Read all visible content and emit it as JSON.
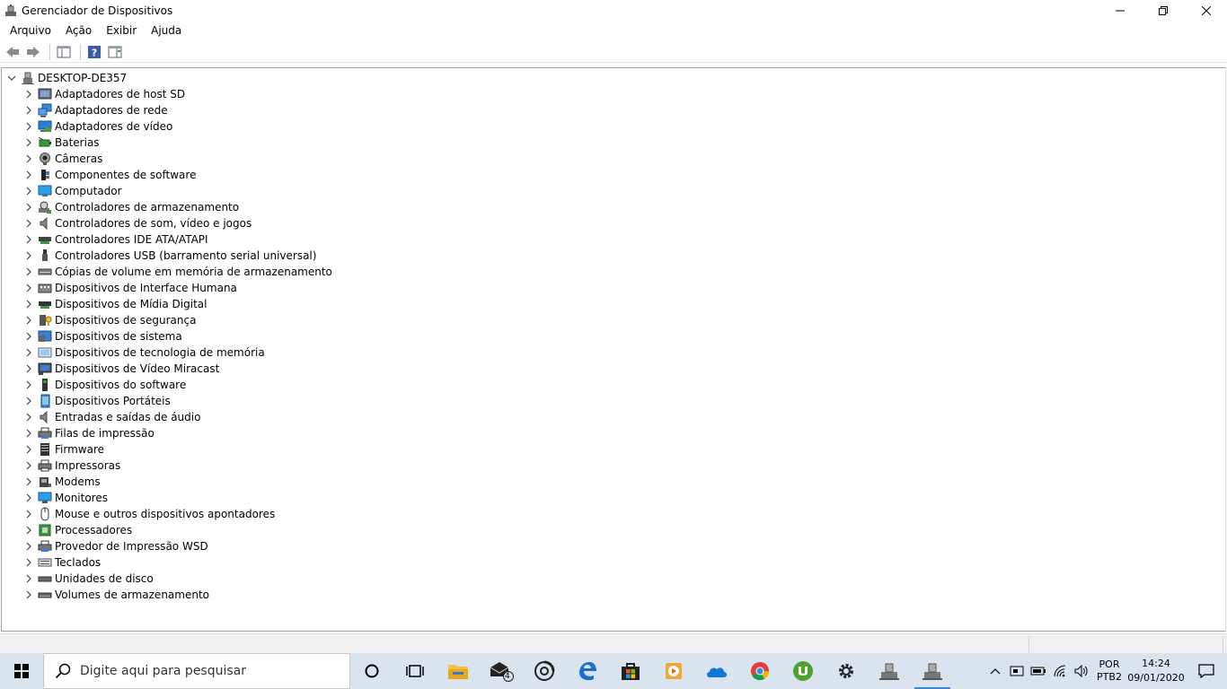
{
  "window": {
    "title": "Gerenciador de Dispositivos"
  },
  "menu": [
    "Arquivo",
    "Ação",
    "Exibir",
    "Ajuda"
  ],
  "tree": {
    "root": "DESKTOP-DE357",
    "items": [
      {
        "label": "Adaptadores de host SD",
        "icon": "sd-host-icon"
      },
      {
        "label": "Adaptadores de rede",
        "icon": "network-adapter-icon"
      },
      {
        "label": "Adaptadores de vídeo",
        "icon": "display-adapter-icon"
      },
      {
        "label": "Baterias",
        "icon": "battery-icon"
      },
      {
        "label": "Câmeras",
        "icon": "camera-icon"
      },
      {
        "label": "Componentes de software",
        "icon": "software-component-icon"
      },
      {
        "label": "Computador",
        "icon": "computer-icon"
      },
      {
        "label": "Controladores de armazenamento",
        "icon": "storage-controller-icon"
      },
      {
        "label": "Controladores de som, vídeo e jogos",
        "icon": "sound-icon"
      },
      {
        "label": "Controladores IDE ATA/ATAPI",
        "icon": "ide-controller-icon"
      },
      {
        "label": "Controladores USB (barramento serial universal)",
        "icon": "usb-icon"
      },
      {
        "label": "Cópias de volume em memória de armazenamento",
        "icon": "volume-shadow-icon"
      },
      {
        "label": "Dispositivos de Interface Humana",
        "icon": "hid-icon"
      },
      {
        "label": "Dispositivos de Mídia Digital",
        "icon": "digital-media-icon"
      },
      {
        "label": "Dispositivos de segurança",
        "icon": "security-device-icon"
      },
      {
        "label": "Dispositivos de sistema",
        "icon": "system-device-icon"
      },
      {
        "label": "Dispositivos de tecnologia de memória",
        "icon": "memory-tech-icon"
      },
      {
        "label": "Dispositivos de Vídeo Miracast",
        "icon": "miracast-icon"
      },
      {
        "label": "Dispositivos do software",
        "icon": "software-device-icon"
      },
      {
        "label": "Dispositivos Portáteis",
        "icon": "portable-device-icon"
      },
      {
        "label": "Entradas e saídas de áudio",
        "icon": "audio-io-icon"
      },
      {
        "label": "Filas de impressão",
        "icon": "print-queue-icon"
      },
      {
        "label": "Firmware",
        "icon": "firmware-icon"
      },
      {
        "label": "Impressoras",
        "icon": "printer-icon"
      },
      {
        "label": "Modems",
        "icon": "modem-icon"
      },
      {
        "label": "Monitores",
        "icon": "monitor-icon"
      },
      {
        "label": "Mouse e outros dispositivos apontadores",
        "icon": "mouse-icon"
      },
      {
        "label": "Processadores",
        "icon": "processor-icon"
      },
      {
        "label": "Provedor de Impressão WSD",
        "icon": "wsd-print-icon"
      },
      {
        "label": "Teclados",
        "icon": "keyboard-icon"
      },
      {
        "label": "Unidades de disco",
        "icon": "disk-drive-icon"
      },
      {
        "label": "Volumes de armazenamento",
        "icon": "storage-volume-icon"
      }
    ]
  },
  "taskbar": {
    "search_placeholder": "Digite aqui para pesquisar",
    "mail_badge": "4",
    "language": "POR",
    "keyboard_layout": "PTB2",
    "time": "14:24",
    "date": "09/01/2020"
  },
  "colors": {
    "taskbar_bg": "#d9e4ef",
    "accent": "#3a86d6"
  }
}
